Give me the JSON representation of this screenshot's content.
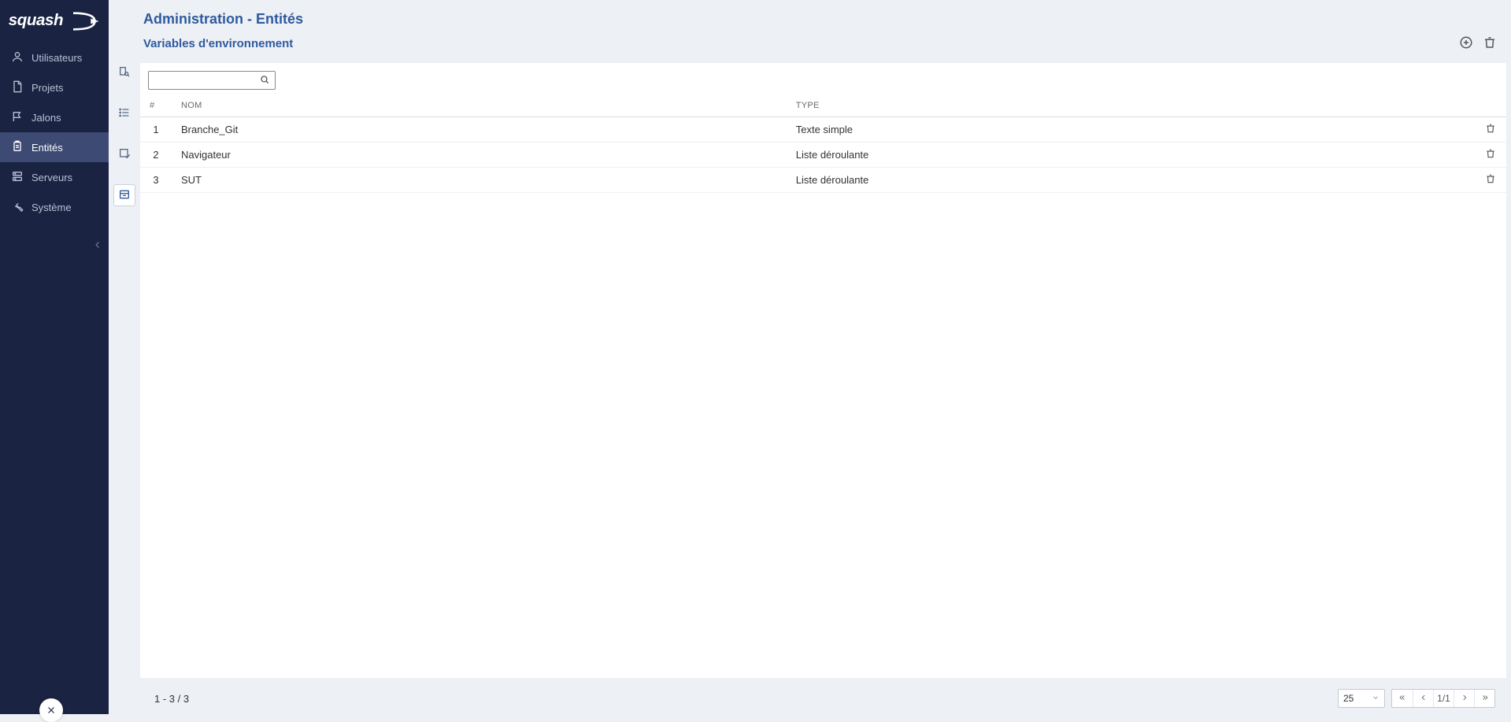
{
  "app": {
    "name": "squash"
  },
  "sidebar": {
    "items": [
      {
        "label": "Utilisateurs"
      },
      {
        "label": "Projets"
      },
      {
        "label": "Jalons"
      },
      {
        "label": "Entités"
      },
      {
        "label": "Serveurs"
      },
      {
        "label": "Système"
      }
    ],
    "active_index": 3
  },
  "toolstrip": {
    "active_index": 3
  },
  "header": {
    "title": "Administration - Entités",
    "subtitle": "Variables d'environnement"
  },
  "search": {
    "value": ""
  },
  "table": {
    "columns": {
      "idx": "#",
      "name": "NOM",
      "type": "TYPE"
    },
    "rows": [
      {
        "idx": "1",
        "name": "Branche_Git",
        "type": "Texte simple"
      },
      {
        "idx": "2",
        "name": "Navigateur",
        "type": "Liste déroulante"
      },
      {
        "idx": "3",
        "name": "SUT",
        "type": "Liste déroulante"
      }
    ]
  },
  "footer": {
    "range": "1 - 3 / 3",
    "page_size": "25",
    "page_label": "1/1"
  }
}
